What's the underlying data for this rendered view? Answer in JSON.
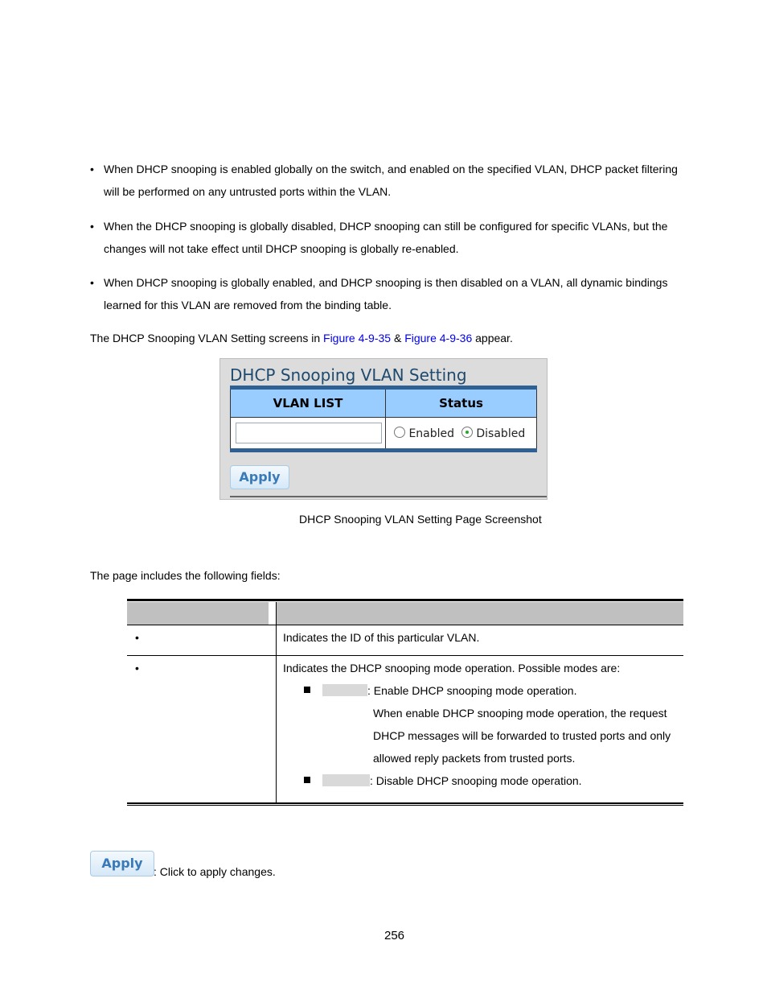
{
  "bullets": [
    {
      "line1": "When DHCP snooping is enabled globally on the switch, and enabled on the specified VLAN, DHCP packet filtering",
      "line2": "will be performed on any untrusted ports within the VLAN."
    },
    {
      "line1": "When the DHCP snooping is globally disabled, DHCP snooping can still be configured for specific VLANs, but the",
      "line2": "changes will not take effect until DHCP snooping is globally re-enabled."
    },
    {
      "line1": "When DHCP snooping is globally enabled, and DHCP snooping is then disabled on a VLAN, all dynamic bindings",
      "line2": "learned for this VLAN are removed from the binding table."
    }
  ],
  "intro": {
    "pre": "The DHCP Snooping VLAN Setting screens in ",
    "link1": "Figure 4-9-35",
    "mid": " & ",
    "link2": "Figure 4-9-36",
    "post": " appear."
  },
  "screenshot": {
    "title": "DHCP Snooping VLAN Setting",
    "col_vlan": "VLAN LIST",
    "col_status": "Status",
    "vlan_value": "",
    "opt_enabled": "Enabled",
    "opt_disabled": "Disabled",
    "selected": "Disabled",
    "apply": "Apply",
    "accent": "#2e6094",
    "header_bg": "#99ccff"
  },
  "caption": "DHCP Snooping VLAN Setting Page Screenshot",
  "fields_intro": "The page includes the following fields:",
  "fields": {
    "row1_desc": "Indicates the ID of this particular VLAN.",
    "row2_desc": "Indicates the DHCP snooping mode operation. Possible modes are:",
    "enable_desc": ": Enable DHCP snooping mode operation.",
    "enable_l2": "When enable DHCP snooping mode operation, the request",
    "enable_l3": "DHCP messages will be forwarded to trusted ports and only",
    "enable_l4": "allowed reply packets from trusted ports.",
    "disable_desc": ": Disable DHCP snooping mode operation."
  },
  "apply_note": {
    "button": "Apply",
    "text": ": Click to apply changes."
  },
  "page_number": "256"
}
